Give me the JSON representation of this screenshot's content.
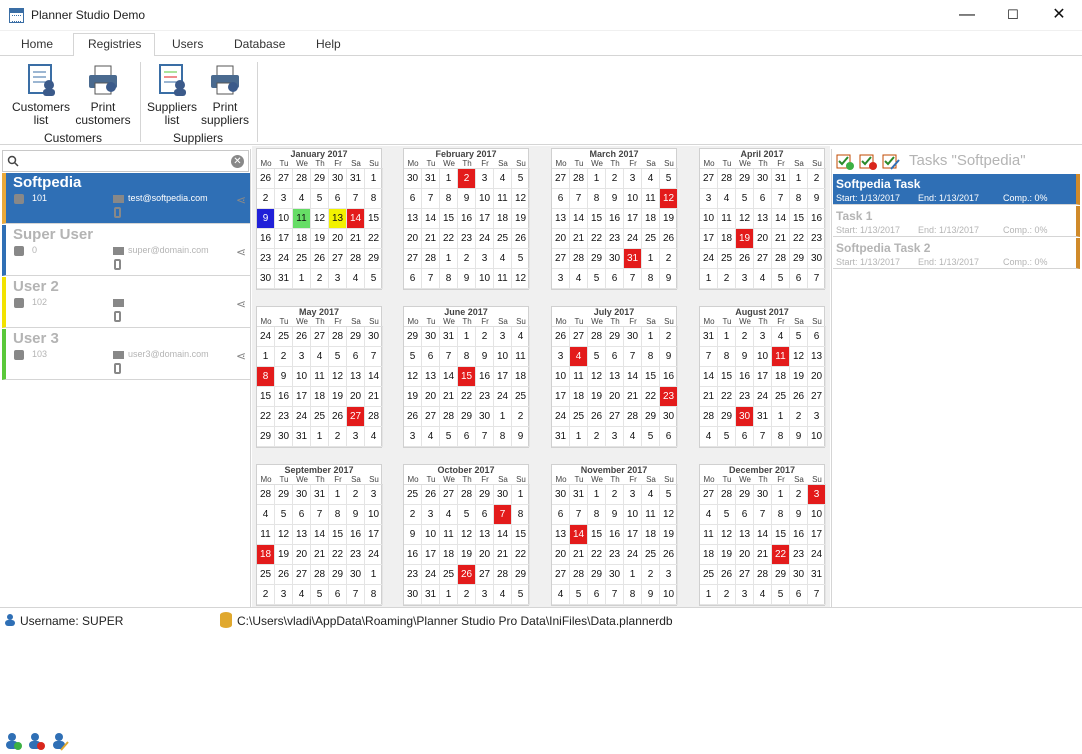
{
  "window": {
    "title": "Planner Studio Demo",
    "minimize": "—",
    "maximize": "☐",
    "close": "✕"
  },
  "tabs": [
    "Home",
    "Registries",
    "Users",
    "Database",
    "Help"
  ],
  "ribbon": {
    "buttons": [
      "Customers\nlist",
      "Print\ncustomers",
      "Suppliers\nlist",
      "Print\nsuppliers"
    ],
    "groups": [
      "Customers",
      "Suppliers"
    ]
  },
  "users": [
    {
      "name": "Softpedia",
      "id": "101",
      "email": "test@softpedia.com",
      "color": "#e9a93b",
      "state": "selected"
    },
    {
      "name": "Super User",
      "id": "0",
      "email": "super@domain.com",
      "color": "#2f6fb5",
      "state": "disabled"
    },
    {
      "name": "User 2",
      "id": "102",
      "email": "",
      "color": "#f2e200",
      "state": "disabled"
    },
    {
      "name": "User 3",
      "id": "103",
      "email": "user3@domain.com",
      "color": "#5ac83a",
      "state": "disabled"
    }
  ],
  "day_headers": [
    "Mo",
    "Tu",
    "We",
    "Th",
    "Fr",
    "Sa",
    "Su"
  ],
  "months": [
    {
      "title": "January 2017",
      "start": 26,
      "prev_len": 31,
      "len": 31,
      "highlights": {
        "9": "#2020d8",
        "11": "#66dd66",
        "13": "#f2f200",
        "14": "#e31b1b"
      }
    },
    {
      "title": "February 2017",
      "start": 30,
      "prev_len": 31,
      "len": 28,
      "highlights": {
        "2": "#e31b1b"
      }
    },
    {
      "title": "March 2017",
      "start": 27,
      "prev_len": 28,
      "len": 31,
      "highlights": {
        "12": "#e31b1b",
        "31": "#e31b1b"
      }
    },
    {
      "title": "April 2017",
      "start": 27,
      "prev_len": 31,
      "len": 30,
      "highlights": {
        "19": "#e31b1b"
      }
    },
    {
      "title": "May 2017",
      "start": 24,
      "prev_len": 30,
      "len": 31,
      "highlights": {
        "8": "#e31b1b",
        "27": "#e31b1b"
      }
    },
    {
      "title": "June 2017",
      "start": 29,
      "prev_len": 31,
      "len": 30,
      "highlights": {
        "15": "#e31b1b"
      }
    },
    {
      "title": "July 2017",
      "start": 26,
      "prev_len": 30,
      "len": 31,
      "highlights": {
        "4": "#e31b1b",
        "23": "#e31b1b"
      }
    },
    {
      "title": "August 2017",
      "start": 31,
      "prev_len": 31,
      "len": 31,
      "highlights": {
        "11": "#e31b1b",
        "30": "#e31b1b"
      }
    },
    {
      "title": "September 2017",
      "start": 28,
      "prev_len": 31,
      "len": 30,
      "highlights": {
        "18": "#e31b1b"
      }
    },
    {
      "title": "October 2017",
      "start": 25,
      "prev_len": 30,
      "len": 31,
      "highlights": {
        "7": "#e31b1b",
        "26": "#e31b1b"
      }
    },
    {
      "title": "November 2017",
      "start": 30,
      "prev_len": 31,
      "len": 30,
      "highlights": {
        "14": "#e31b1b"
      }
    },
    {
      "title": "December 2017",
      "start": 27,
      "prev_len": 30,
      "len": 31,
      "highlights": {
        "3": "#e31b1b",
        "22": "#e31b1b"
      }
    }
  ],
  "tasks_title": "Tasks \"Softpedia\"",
  "tasks": [
    {
      "name": "Softpedia Task",
      "start": "Start: 1/13/2017",
      "end": "End: 1/13/2017",
      "comp": "Comp.: 0%",
      "state": "selected"
    },
    {
      "name": "Task 1",
      "start": "Start: 1/13/2017",
      "end": "End: 1/13/2017",
      "comp": "Comp.: 0%",
      "state": "disabled"
    },
    {
      "name": "Softpedia Task 2",
      "start": "Start: 1/13/2017",
      "end": "End: 1/13/2017",
      "comp": "Comp.: 0%",
      "state": "disabled"
    }
  ],
  "status": {
    "username": "Username: SUPER",
    "path": "C:\\Users\\vladi\\AppData\\Roaming\\Planner Studio Pro Data\\IniFiles\\Data.plannerdb"
  }
}
